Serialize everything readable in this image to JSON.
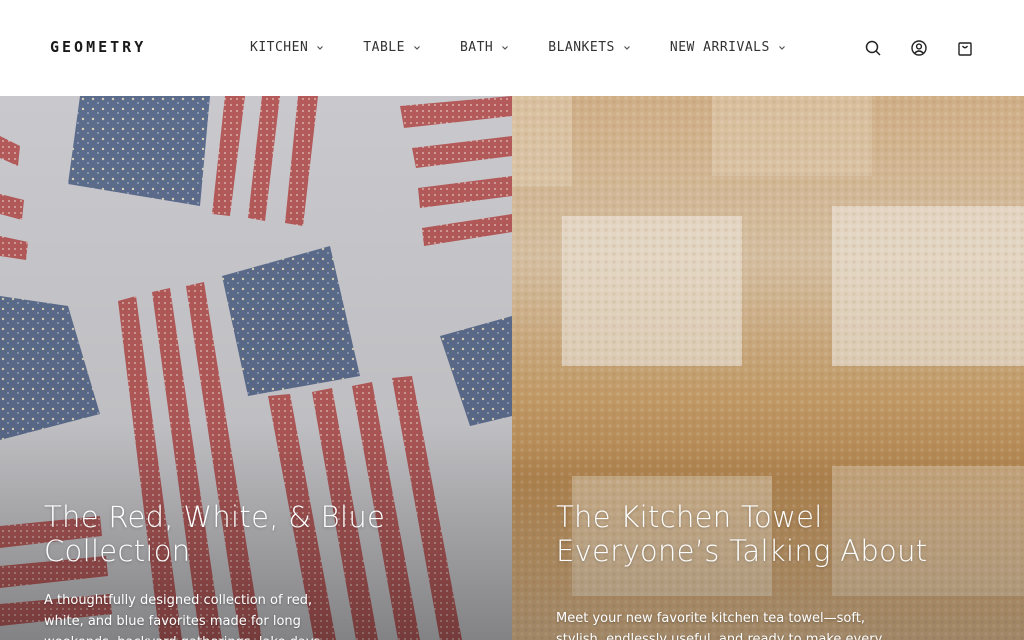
{
  "header": {
    "logo": "GEOMETRY",
    "nav": [
      {
        "label": "KITCHEN"
      },
      {
        "label": "TABLE"
      },
      {
        "label": "BATH"
      },
      {
        "label": "BLANKETS"
      },
      {
        "label": "NEW ARRIVALS"
      }
    ],
    "icons": [
      "search-icon",
      "account-icon",
      "cart-icon"
    ]
  },
  "hero_left": {
    "title": "The Red, White, & Blue Collection",
    "description": "A thoughtfully designed collection of red, white, and blue favorites made for long weekends, backyard gatherings, lake days,"
  },
  "hero_right": {
    "title_line1": "The Kitchen Towel",
    "title_line2": "Everyone’s Talking About",
    "description": "Meet your new favorite kitchen tea towel—soft, stylish, endlessly useful, and ready to make every"
  },
  "colors": {
    "quilt_background": "#c9c9cd",
    "quilt_blue": "#5c6c8c",
    "quilt_red": "#b45a5a",
    "towel_tan": "#d7b58c",
    "towel_cream": "#e9dcc8"
  }
}
